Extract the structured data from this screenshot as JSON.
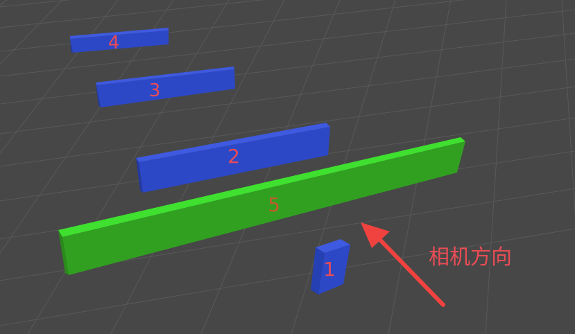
{
  "scene": {
    "objects": [
      {
        "label": "1",
        "color": "#2d48c6"
      },
      {
        "label": "2",
        "color": "#2d48c6"
      },
      {
        "label": "3",
        "color": "#2d48c6"
      },
      {
        "label": "4",
        "color": "#2d48c6"
      },
      {
        "label": "5",
        "color": "#31a021"
      }
    ],
    "annotation": {
      "text": "相机方向",
      "arrow_color": "#f0423f",
      "icon": "arrow-icon"
    },
    "colors": {
      "background": "#474747",
      "grid": "#5a5a5a",
      "blue_block": "#2d48c6",
      "green_block": "#31a021",
      "label": "#ea4c55"
    }
  }
}
